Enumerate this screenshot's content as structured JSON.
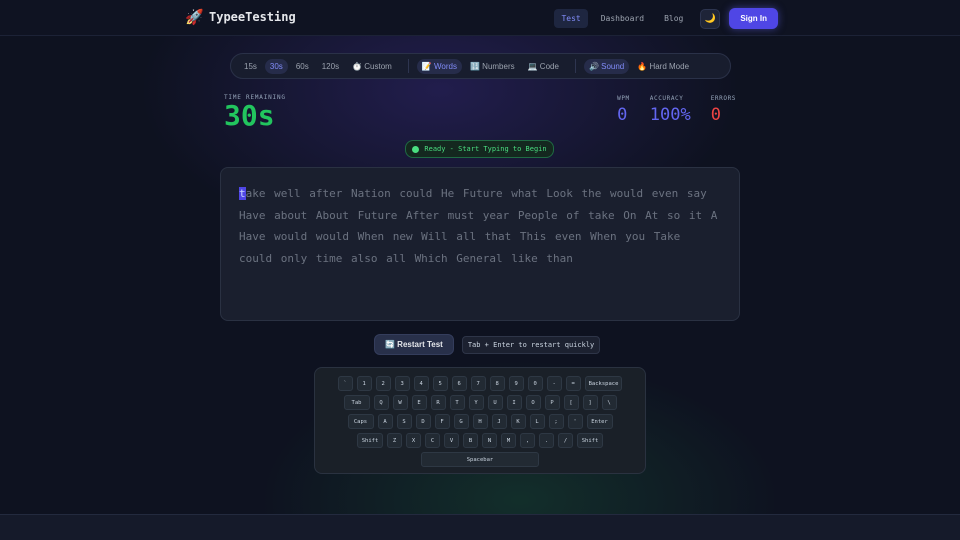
{
  "header": {
    "logo_icon": "rocket-icon",
    "title": "TypeeTesting",
    "nav": [
      "Test",
      "Dashboard",
      "Blog"
    ],
    "theme_icon": "🌙",
    "signin": "Sign In"
  },
  "modes": {
    "times": [
      "15s",
      "30s",
      "60s",
      "120s",
      "⏱️ Custom"
    ],
    "content": [
      "📝 Words",
      "🔢 Numbers",
      "💻 Code"
    ],
    "options": [
      "🔊 Sound",
      "🔥 Hard Mode"
    ]
  },
  "timer": {
    "label": "TIME REMAINING",
    "value": "30s"
  },
  "stats": {
    "wpm_label": "WPM",
    "wpm": "0",
    "accuracy_label": "ACCURACY",
    "accuracy": "100%",
    "errors_label": "ERRORS",
    "errors": "0"
  },
  "status": "Ready - Start Typing to Begin",
  "text": {
    "first_char": "t",
    "rest": "ake well after Nation could He Future what Look the would even say Have about About Future After must year People of take On At so it A Have would would When new Will all that This even When you Take could only time also all Which General like than"
  },
  "restart": {
    "label": "🔄 Restart Test",
    "hint": "Tab + Enter to restart quickly"
  },
  "keyboard": {
    "row1": [
      "`",
      "1",
      "2",
      "3",
      "4",
      "5",
      "6",
      "7",
      "8",
      "9",
      "0",
      "-",
      "=",
      "Backspace"
    ],
    "row2": [
      "Tab",
      "Q",
      "W",
      "E",
      "R",
      "T",
      "Y",
      "U",
      "I",
      "O",
      "P",
      "[",
      "]",
      "\\"
    ],
    "row3": [
      "Caps",
      "A",
      "S",
      "D",
      "F",
      "G",
      "H",
      "J",
      "K",
      "L",
      ";",
      "'",
      "Enter"
    ],
    "row4": [
      "Shift",
      "Z",
      "X",
      "C",
      "V",
      "B",
      "N",
      "M",
      ",",
      ".",
      "/",
      "Shift"
    ],
    "row5": [
      "Spacebar"
    ]
  },
  "colors": {
    "accent": "#4f46e5",
    "timer": "#22c55e",
    "errors": "#ef4444"
  }
}
